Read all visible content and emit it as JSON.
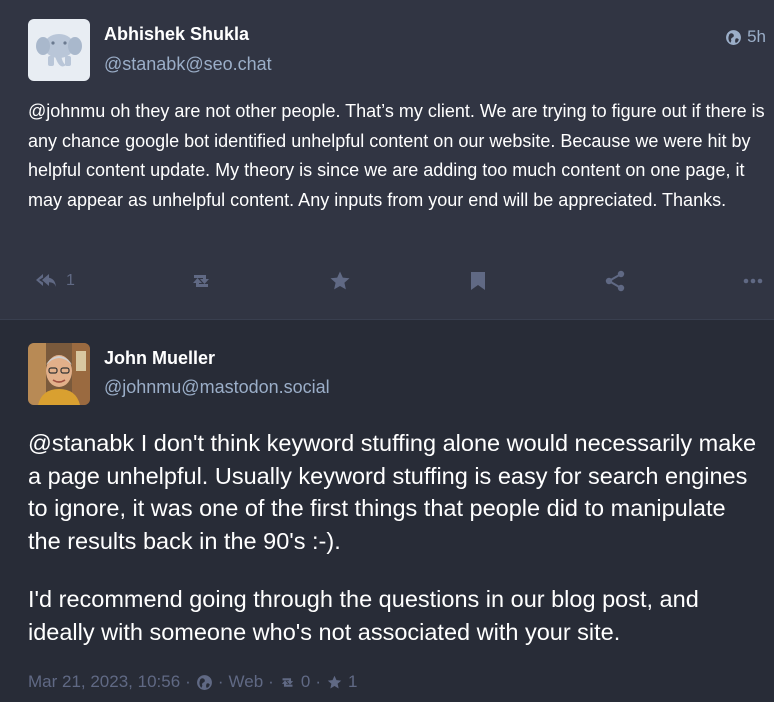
{
  "reply_status": {
    "display_name": "Abhishek Shukla",
    "handle": "@stanabk@seo.chat",
    "time": "5h",
    "mention": "@johnmu",
    "text": " oh they are not other people. That’s my client. We are trying to figure out if there is any chance google bot identified unhelpful content on our website. Because we were hit by helpful content update. My theory is since we are adding too much content on one page, it may appear as unhelpful content. Any inputs from your end will be appreciated. Thanks.",
    "reply_count": "1",
    "icons": {
      "reply": "reply-all-icon",
      "boost": "retweet-icon",
      "favourite": "star-icon",
      "bookmark": "bookmark-icon",
      "share": "share-icon",
      "more": "ellipsis-icon",
      "visibility": "globe-icon"
    },
    "colors": {
      "background": "#313543",
      "muted": "#9baec8",
      "icon": "#606984"
    }
  },
  "focal_status": {
    "display_name": "John Mueller",
    "handle": "@johnmu@mastodon.social",
    "paragraph1_mention": "@stanabk",
    "paragraph1_text": " I don't think keyword stuffing alone would necessarily make a page unhelpful. Usually keyword stuffing is easy for search engines to ignore, it was one of the first things that people did to manipulate the results back in the 90's :-).",
    "paragraph2_text": "I'd recommend going through the questions in our blog post, and ideally with someone who's not associated with your site.",
    "date": "Mar 21, 2023, 10:56",
    "separator": "·",
    "application": "Web",
    "boosts": "0",
    "favourites": "1",
    "colors": {
      "background": "#282c37",
      "muted": "#606984"
    }
  }
}
